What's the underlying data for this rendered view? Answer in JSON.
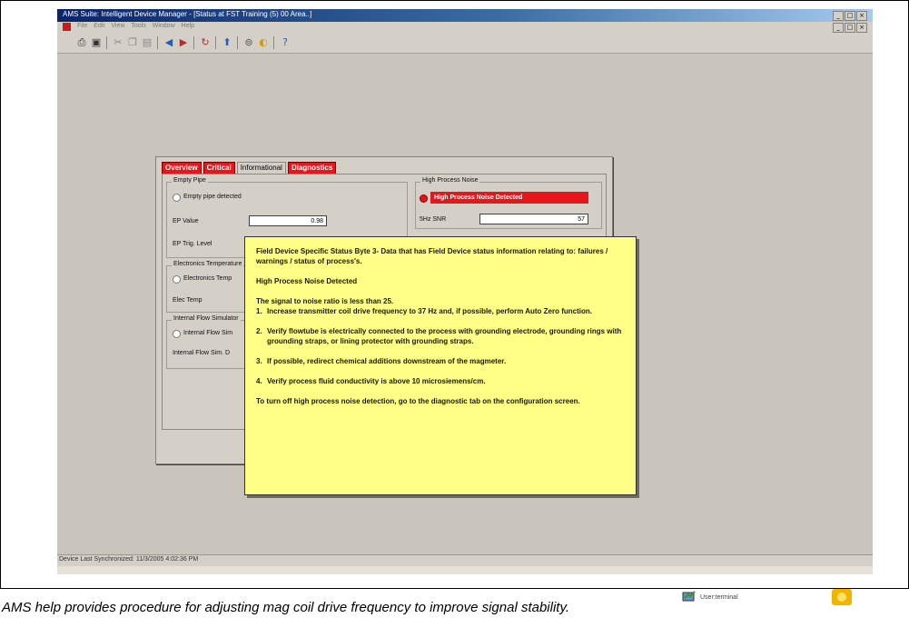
{
  "window": {
    "title": "AMS Suite: Intelligent Device Manager - [Status at FST Training (5) 00 Area..]",
    "menu": [
      "File",
      "Edit",
      "View",
      "Tools",
      "Window",
      "Help"
    ]
  },
  "dialog": {
    "tabs": [
      "Overview",
      "Critical",
      "Informational",
      "Diagnostics"
    ],
    "empty_pipe": {
      "title": "Empty Pipe",
      "radio_label": "Empty pipe detected",
      "ep_value_label": "EP Value",
      "ep_value": "0.98",
      "ep_trig_label": "EP Trig. Level"
    },
    "high_process_noise": {
      "title": "High Process Noise",
      "alarm_label": "High Process Noise Detected",
      "hz_label": "5Hz SNR",
      "hz_value": "57"
    },
    "electronics_temp": {
      "title": "Electronics Temperature",
      "radio_label": "Electronics Temp",
      "elec_temp_label": "Elec Temp"
    },
    "internal_flow": {
      "title": "Internal Flow Simulator",
      "radio_label": "Internal Flow Sim",
      "value_label": "Internal Flow Sim. D"
    }
  },
  "tooltip": {
    "intro": "Field Device Specific Status Byte 3- Data that has Field Device status information relating to: failures / warnings / status of process's.",
    "heading": "High Process Noise Detected",
    "lead": "The signal to noise ratio is less than 25.",
    "steps": [
      {
        "num": "1.",
        "text": "Increase transmitter coil drive frequency to 37 Hz and, if possible, perform Auto Zero function."
      },
      {
        "num": "2.",
        "text": "Verify flowtube is electrically connected to the process with grounding electrode, grounding rings with grounding straps, or lining protector with grounding straps."
      },
      {
        "num": "3.",
        "text": "If possible, redirect chemical additions downstream of the magmeter."
      },
      {
        "num": "4.",
        "text": "Verify process fluid conductivity is above 10 microsiemens/cm."
      }
    ],
    "footer": "To turn off high process noise detection, go to the diagnostic tab on the configuration screen."
  },
  "statusbar": {
    "text": "Device Last Synchronized: 11/3/2005 4:02:36 PM"
  },
  "tray": {
    "user_label": "User:terminal"
  },
  "caption": "AMS help provides procedure for adjusting mag coil drive frequency to improve signal stability.",
  "colors": {
    "alarm_red": "#e8151b",
    "tooltip_yellow": "#ffff88",
    "window_gray": "#d4d0c8"
  }
}
